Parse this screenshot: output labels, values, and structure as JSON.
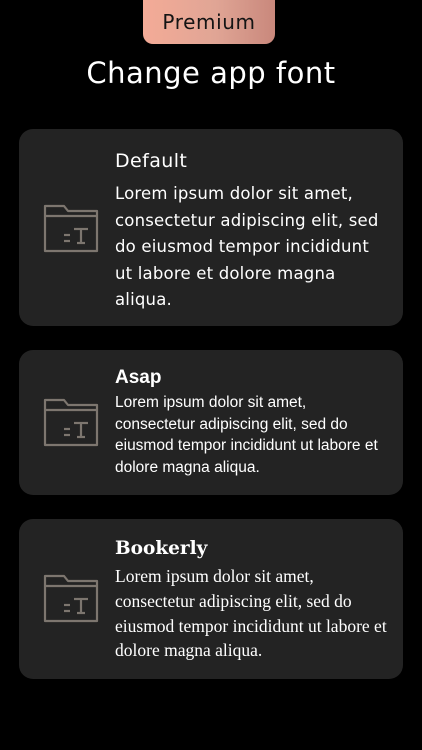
{
  "premium": {
    "label": "Premium",
    "gradient_start": "#f4ab97",
    "gradient_end": "#c9887c"
  },
  "header": {
    "title": "Change app font"
  },
  "colors": {
    "background": "#000000",
    "card_background": "#232323",
    "icon_stroke": "#7d766f",
    "text": "#ffffff"
  },
  "fonts": [
    {
      "name": "Default",
      "sample": "Lorem ipsum dolor sit amet, consectetur adipiscing elit, sed do eiusmod tempor incididunt ut labore et dolore magna aliqua.",
      "icon": "font-folder-icon"
    },
    {
      "name": "Asap",
      "sample": "Lorem ipsum dolor sit amet, consectetur adipiscing elit, sed do eiusmod tempor incididunt ut labore et dolore magna aliqua.",
      "icon": "font-folder-icon"
    },
    {
      "name": "Bookerly",
      "sample": "Lorem ipsum dolor sit amet, consectetur adipiscing elit, sed do eiusmod tempor  incididunt ut labore et dolore magna aliqua.",
      "icon": "font-folder-icon"
    }
  ]
}
